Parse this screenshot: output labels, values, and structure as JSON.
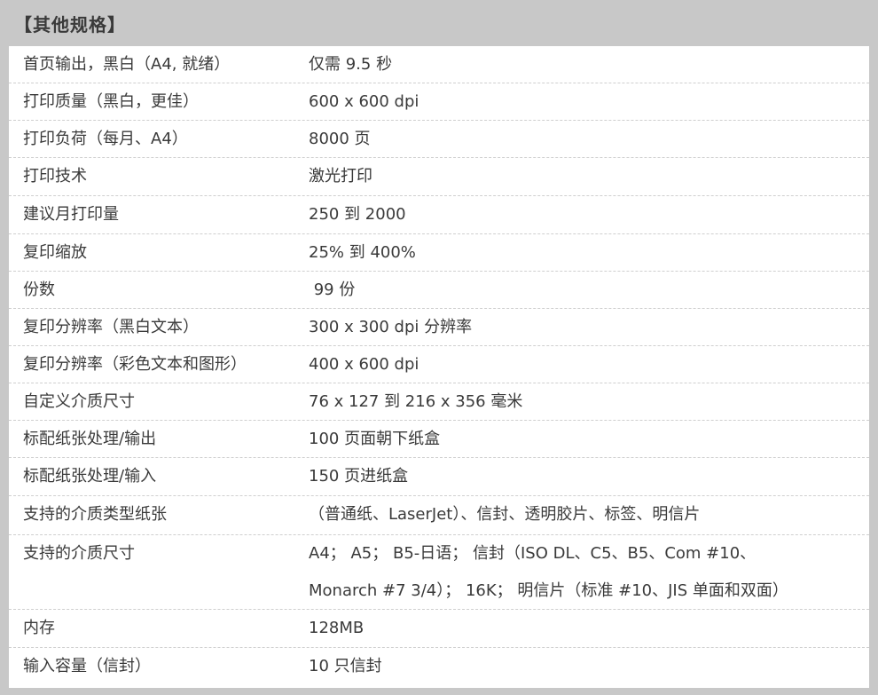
{
  "title": "【其他规格】",
  "rows": [
    {
      "label": "首页输出，黑白（A4, 就绪）",
      "value": "仅需 9.5 秒"
    },
    {
      "label": "打印质量（黑白，更佳）",
      "value": "600 x 600 dpi"
    },
    {
      "label": "打印负荷（每月、A4）",
      "value": "8000 页"
    },
    {
      "label": "打印技术",
      "value": "激光打印"
    },
    {
      "label": "建议月打印量",
      "value": "250 到 2000"
    },
    {
      "label": "复印缩放",
      "value": "25% 到 400%"
    },
    {
      "label": "份数",
      "value": " 99 份"
    },
    {
      "label": "复印分辨率（黑白文本）",
      "value": "300 x 300 dpi 分辨率"
    },
    {
      "label": "复印分辨率（彩色文本和图形）",
      "value": "400 x 600 dpi"
    },
    {
      "label": "自定义介质尺寸",
      "value": "76 x 127 到 216 x 356 毫米"
    },
    {
      "label": "标配纸张处理/输出",
      "value": "100 页面朝下纸盒"
    },
    {
      "label": "标配纸张处理/输入",
      "value": "150 页进纸盒"
    },
    {
      "label": "支持的介质类型纸张",
      "value": "（普通纸、LaserJet）、信封、透明胶片、标签、明信片"
    },
    {
      "label": "支持的介质尺寸",
      "value": "A4； A5； B5-日语； 信封（ISO DL、C5、B5、Com #10、",
      "value2": "Monarch #7 3/4）； 16K； 明信片（标准 #10、JIS 单面和双面）"
    },
    {
      "label": "内存",
      "value": "128MB"
    },
    {
      "label": "输入容量（信封）",
      "value": "10 只信封"
    }
  ]
}
